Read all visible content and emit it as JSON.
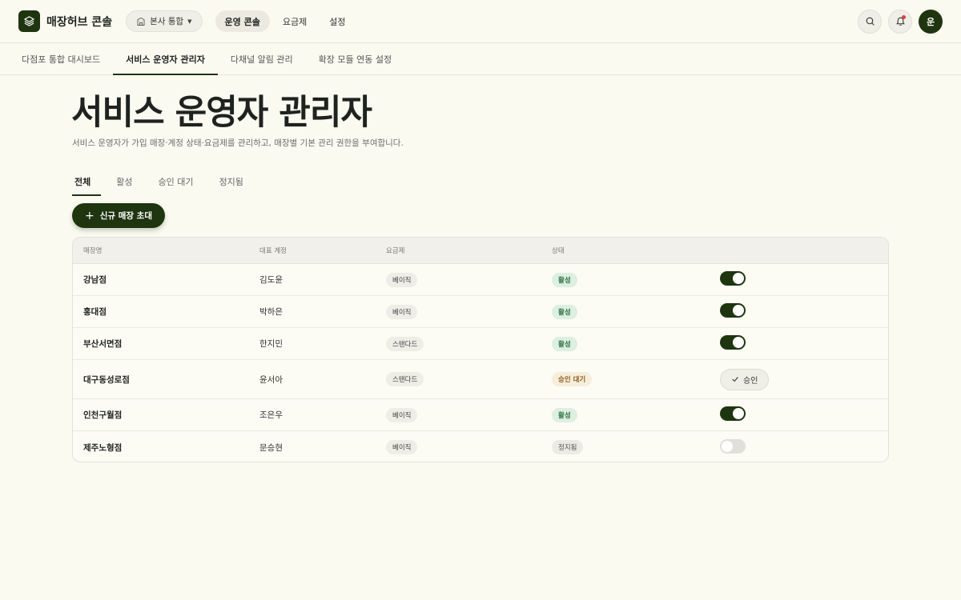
{
  "topbar": {
    "brand": "매장허브 콘솔",
    "org_select": "본사 통합",
    "nav": [
      "운영 콘솔",
      "요금제",
      "설정"
    ],
    "avatar_initial": "운"
  },
  "subnav": [
    "다점포 통합 대시보드",
    "서비스 운영자 관리자",
    "다채널 알림 관리",
    "확장 모듈 연동 설정"
  ],
  "header": {
    "title": "서비스 운영자 관리자",
    "description": "서비스 운영자가 가입 매장·계정 상태·요금제를 관리하고, 매장별 기본 관리 권한을 부여합니다."
  },
  "tabs": [
    "전체",
    "활성",
    "승인 대기",
    "정지됨"
  ],
  "primary_button": "신규 매장 초대",
  "table": {
    "columns": [
      "매장명",
      "대표 계정",
      "요금제",
      "상태",
      ""
    ],
    "rows": [
      {
        "store": "강남점",
        "owner": "김도윤",
        "plan": "베이직",
        "status": "활성",
        "status_type": "active",
        "action": "toggle-on"
      },
      {
        "store": "홍대점",
        "owner": "박하은",
        "plan": "베이직",
        "status": "활성",
        "status_type": "active",
        "action": "toggle-on"
      },
      {
        "store": "부산서면점",
        "owner": "한지민",
        "plan": "스탠다드",
        "status": "활성",
        "status_type": "active",
        "action": "toggle-on"
      },
      {
        "store": "대구동성로점",
        "owner": "윤서아",
        "plan": "스탠다드",
        "status": "승인 대기",
        "status_type": "pending",
        "action": "approve"
      },
      {
        "store": "인천구월점",
        "owner": "조은우",
        "plan": "베이직",
        "status": "활성",
        "status_type": "active",
        "action": "toggle-on"
      },
      {
        "store": "제주노형점",
        "owner": "문승현",
        "plan": "베이직",
        "status": "정지됨",
        "status_type": "stopped",
        "action": "toggle-off"
      }
    ],
    "approve_label": "승인"
  },
  "colors": {
    "brand": "#1e3510",
    "background": "#fbfaf1",
    "active_badge": "#dcefe0",
    "pending_badge": "#f7eddb",
    "notification_dot": "#d94141"
  },
  "icons": {
    "logo": "layers-icon",
    "org": "building-icon",
    "search": "search-icon",
    "notifications": "bell-icon",
    "add": "plus-icon",
    "approve": "check-icon"
  }
}
